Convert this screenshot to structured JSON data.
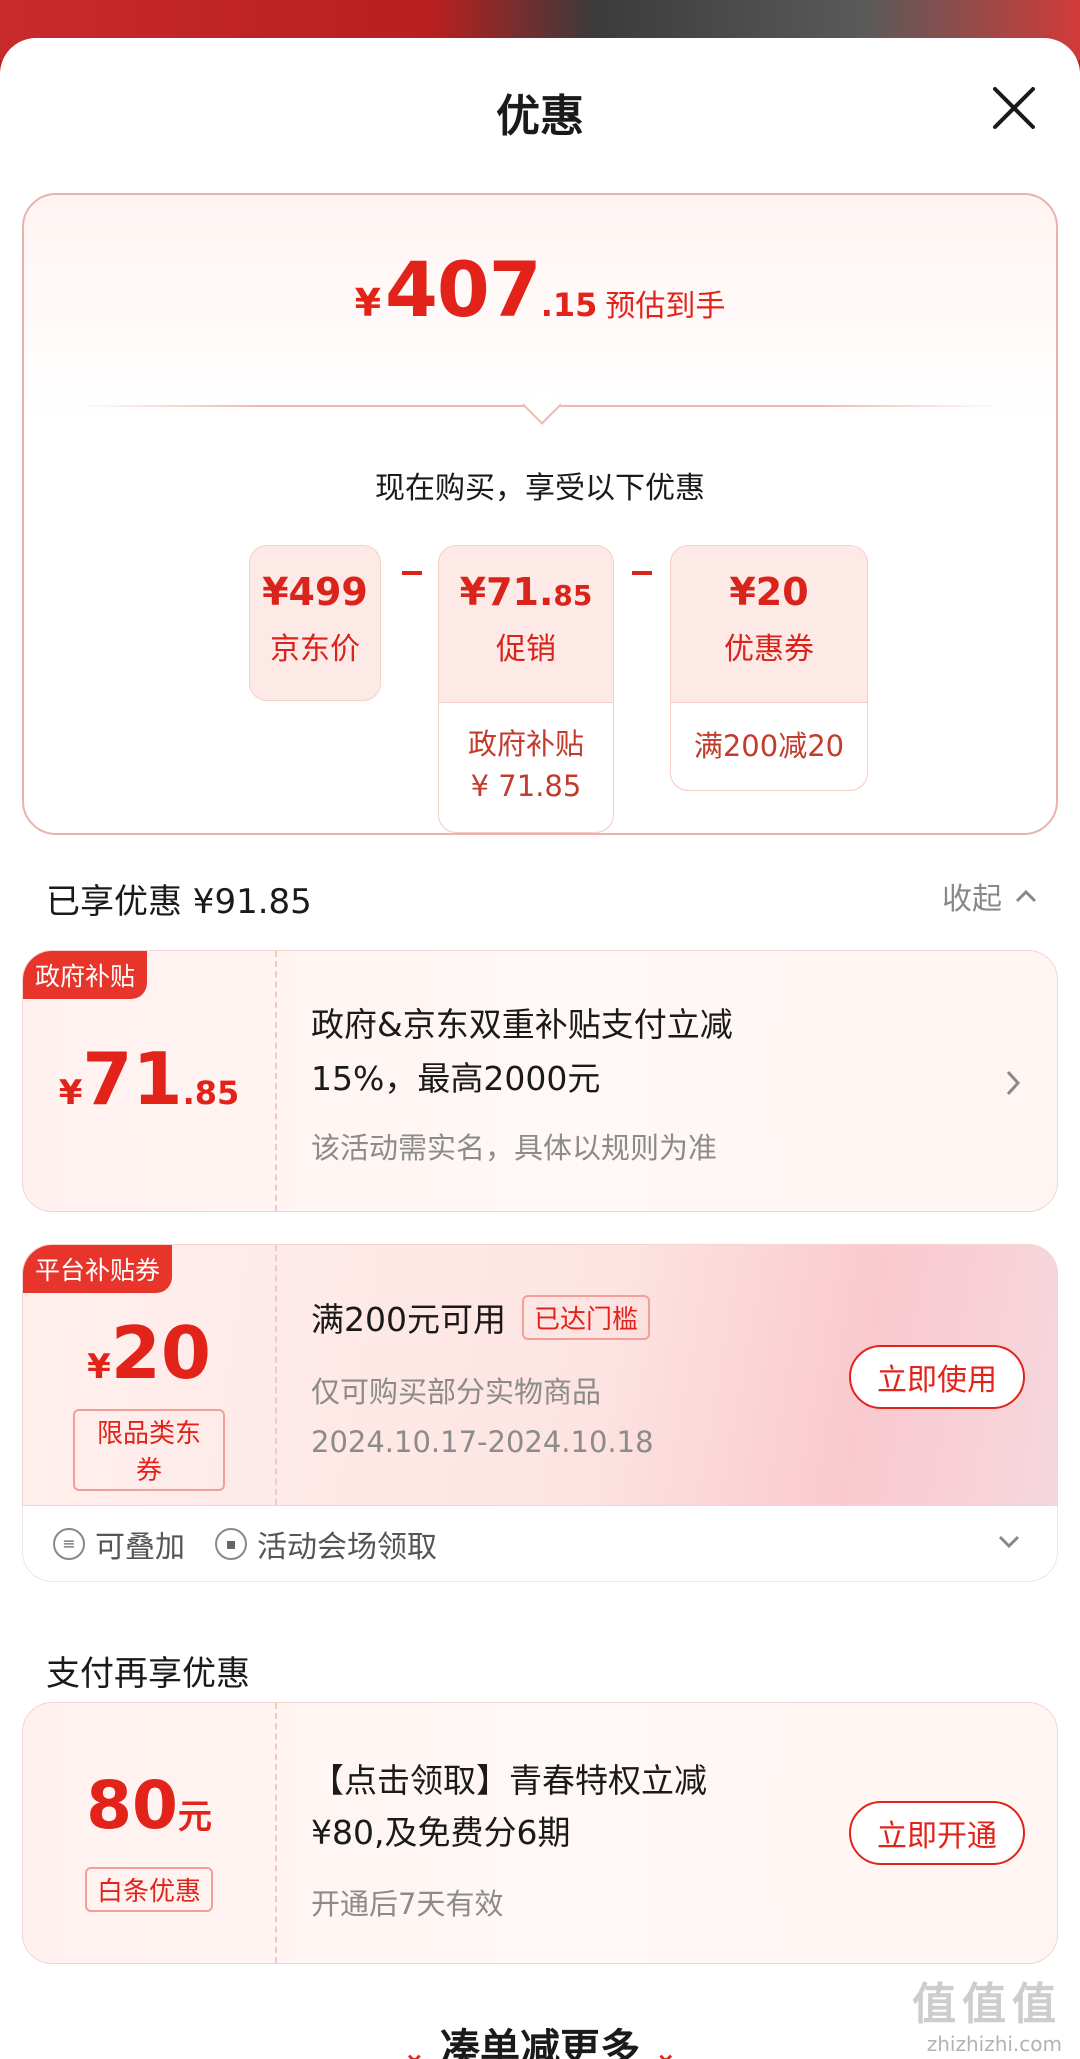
{
  "sheet": {
    "title": "优惠"
  },
  "summary": {
    "currency": "¥",
    "est_int": "407",
    "est_dec": ".15",
    "est_label": "预估到手",
    "buy_now_text": "现在购买，享受以下优惠",
    "chips": [
      {
        "value": "¥499",
        "label": "京东价"
      },
      {
        "value_main": "¥71.",
        "value_small": "85",
        "label": "促销",
        "sub_line1": "政府补贴",
        "sub_line2": "¥ 71.85"
      },
      {
        "value": "¥20",
        "label": "优惠券",
        "sub_line1": "满200减20"
      }
    ]
  },
  "enjoyed": {
    "title": "已享优惠 ¥91.85",
    "collapse_label": "收起"
  },
  "coupons": [
    {
      "tag": "政府补贴",
      "cur": "¥",
      "int": "71",
      "dec": ".85",
      "title_line1": "政府&京东双重补贴支付立减",
      "title_line2": "15%，最高2000元",
      "desc": "该活动需实名，具体以规则为准"
    },
    {
      "tag": "平台补贴券",
      "cur": "¥",
      "int": "20",
      "sub_badge": "限品类东券",
      "title": "满200元可用",
      "status_badge": "已达门槛",
      "desc1": "仅可购买部分实物商品",
      "desc2": "2024.10.17-2024.10.18",
      "button": "立即使用",
      "foot_stackable": "可叠加",
      "foot_source": "活动会场领取"
    }
  ],
  "payment": {
    "title": "支付再享优惠",
    "amount": "80",
    "unit": "元",
    "sub_badge": "白条优惠",
    "title_line1": "【点击领取】青春特权立减",
    "title_line2": "¥80,及免费分6期",
    "desc": "开通后7天有效",
    "button": "立即开通"
  },
  "bottom": {
    "more_label": "凑单减更多"
  },
  "watermark": {
    "line1": "值值值",
    "line2": "zhizhizhi.com"
  },
  "colors": {
    "accent": "#e2231a",
    "chip_bg": "#fde9e6",
    "tag_bg": "#e8352b"
  }
}
